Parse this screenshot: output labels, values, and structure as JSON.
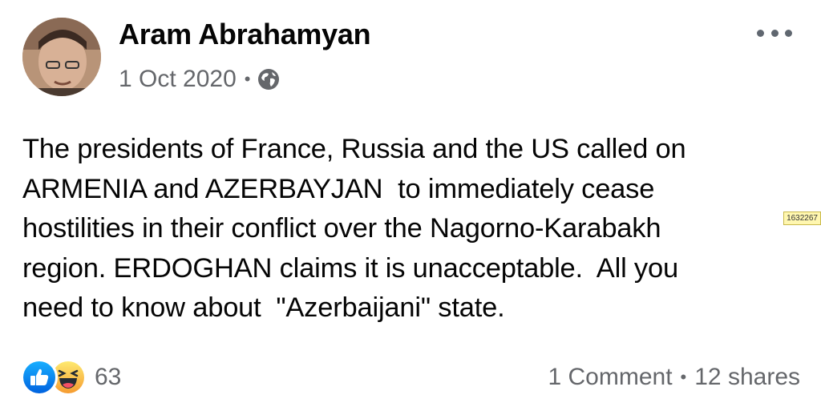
{
  "post": {
    "author": "Aram Abrahamyan",
    "date": "1 Oct 2020",
    "separator": "•",
    "privacy_icon": "globe-icon",
    "more_icon": "more-options-icon",
    "text": "The presidents of France, Russia and the US called on\nARMENIA and AZERBAYJAN  to immediately cease\nhostilities in their conflict over the Nagorno-Karabakh\nregion. ERDOGHAN claims it is unacceptable.  All you\nneed to know about  \"Azerbaijani\" state."
  },
  "overlay_tag": "1632267",
  "footer": {
    "reactions": [
      "like-reaction-icon",
      "haha-reaction-icon"
    ],
    "reaction_count": "63",
    "comments": "1 Comment",
    "separator": "•",
    "shares": "12 shares"
  },
  "colors": {
    "text": "#050505",
    "secondary": "#65676b",
    "like_blue": "#1877f2",
    "haha_yellow": "#f7b125"
  }
}
